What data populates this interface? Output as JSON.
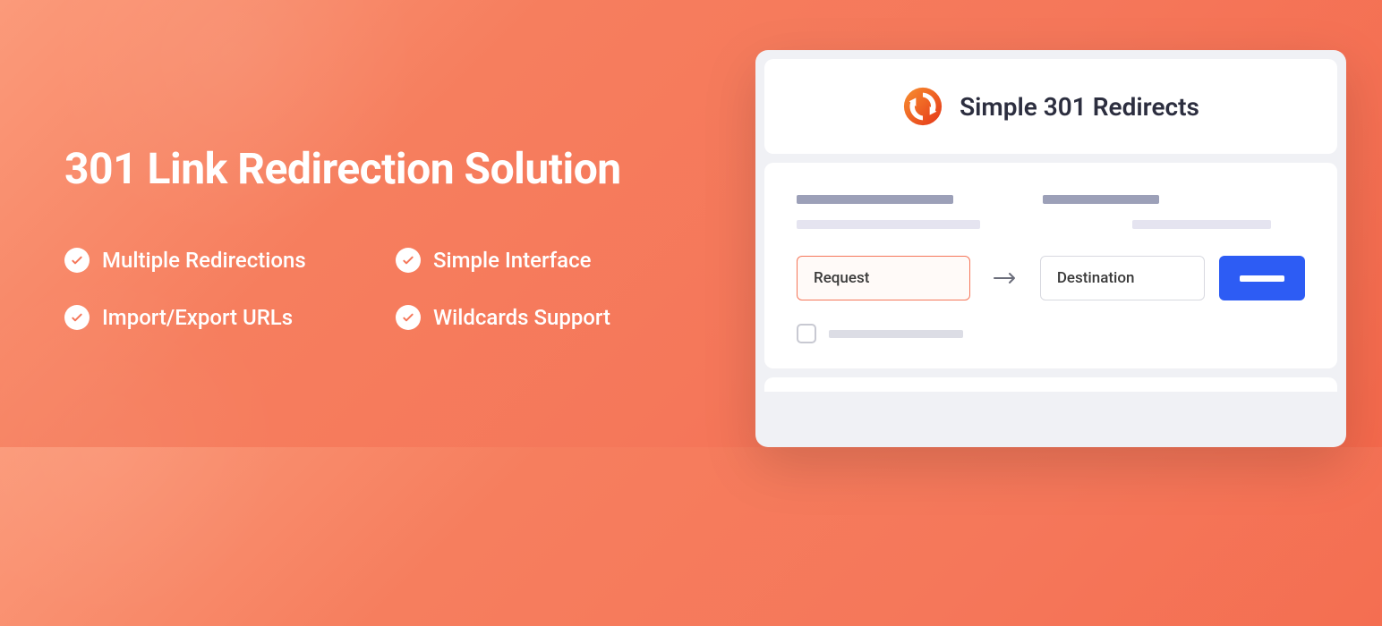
{
  "marketing": {
    "headline": "301 Link Redirection Solution",
    "features": [
      "Multiple Redirections",
      "Simple Interface",
      "Import/Export URLs",
      "Wildcards Support"
    ]
  },
  "app": {
    "title": "Simple 301 Redirects",
    "form": {
      "request_label": "Request",
      "destination_label": "Destination"
    }
  },
  "colors": {
    "accent": "#f5775a",
    "primary_button": "#2d5cf4"
  }
}
